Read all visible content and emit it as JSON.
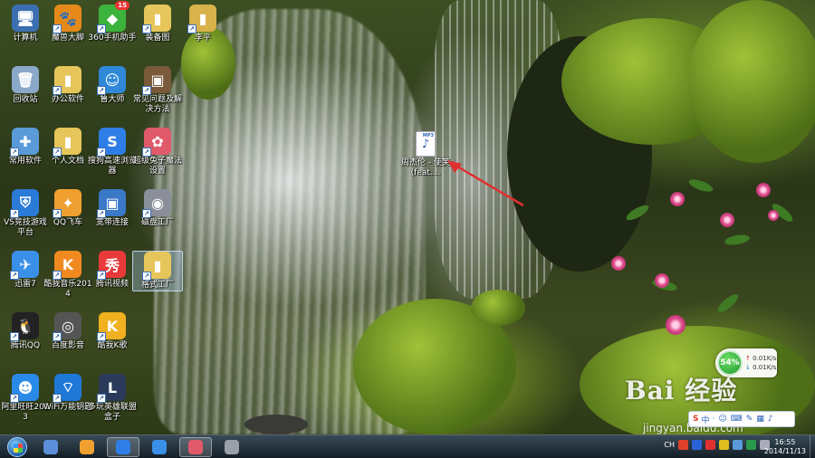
{
  "desktop_icons": [
    {
      "label": "计算机",
      "glyph": "🖥",
      "color": "#3b6fb0"
    },
    {
      "label": "魔兽大脚",
      "glyph": "🐾",
      "color": "#e58a1a"
    },
    {
      "label": "360手机助手",
      "glyph": "◆",
      "color": "#3cb33c",
      "badge": "15"
    },
    {
      "label": "装备图",
      "glyph": "▮",
      "color": "#e6c55a"
    },
    {
      "label": "李平",
      "glyph": "▮",
      "color": "#d8b24a"
    },
    {
      "label": "回收站",
      "glyph": "🗑",
      "color": "#8aa9c9"
    },
    {
      "label": "办公软件",
      "glyph": "▮",
      "color": "#e6c55a"
    },
    {
      "label": "鲁大师",
      "glyph": "☺",
      "color": "#2f88d8"
    },
    {
      "label": "常见问题及解决方法",
      "glyph": "▣",
      "color": "#7a5a3a"
    },
    {
      "label": "常用软件",
      "glyph": "✚",
      "color": "#5a9ad8"
    },
    {
      "label": "个人文档",
      "glyph": "▮",
      "color": "#e6c55a"
    },
    {
      "label": "搜狗高速浏览器",
      "glyph": "S",
      "color": "#2f7ee8"
    },
    {
      "label": "超级兔子魔法设置",
      "glyph": "✿",
      "color": "#e05a6a"
    },
    {
      "label": "VS竞技游戏平台",
      "glyph": "⛨",
      "color": "#2a7ad8"
    },
    {
      "label": "QQ飞车",
      "glyph": "✦",
      "color": "#f0a030"
    },
    {
      "label": "宽带连接",
      "glyph": "▣",
      "color": "#3a78c8"
    },
    {
      "label": "磁盘工厂",
      "glyph": "◉",
      "color": "#8a8f99"
    },
    {
      "label": "迅雷7",
      "glyph": "✈",
      "color": "#3a90e8"
    },
    {
      "label": "酷我音乐2014",
      "glyph": "K",
      "color": "#f08a20"
    },
    {
      "label": "腾讯视频",
      "glyph": "秀",
      "color": "#e83a3a"
    },
    {
      "label": "格式工厂",
      "glyph": "▮",
      "color": "#e6c55a"
    },
    {
      "label": "腾讯QQ",
      "glyph": "🐧",
      "color": "#222"
    },
    {
      "label": "百度影音",
      "glyph": "◎",
      "color": "#555"
    },
    {
      "label": "酷我K歌",
      "glyph": "K",
      "color": "#f0b020"
    },
    {
      "label": "阿里旺旺2013",
      "glyph": "☻",
      "color": "#2a8ae8"
    },
    {
      "label": "WiFi万能钥匙",
      "glyph": "⌔",
      "color": "#1e78d8"
    },
    {
      "label": "多玩英雄联盟盒子",
      "glyph": "L",
      "color": "#2a3a5a"
    }
  ],
  "file_icon": {
    "label": "周杰伦 - 使笑 (feat....",
    "type_label": "MP3",
    "glyph": "♪"
  },
  "net_speed": {
    "percent": "54%",
    "upload": "0.01K/s",
    "download": "0.01K/s"
  },
  "ime": {
    "brand": "S",
    "mode": "中",
    "items": [
      "·",
      "☺",
      "⌨",
      "✎",
      "▦",
      "♪"
    ]
  },
  "watermark": {
    "text": "Bai 经验",
    "url": "jingyan.baidu.com"
  },
  "taskbar": {
    "apps": [
      {
        "name": "media-player",
        "color": "#5b8fd8"
      },
      {
        "name": "360-browser",
        "color": "#f0a030"
      },
      {
        "name": "sogou-browser",
        "color": "#2f7ee8"
      },
      {
        "name": "xunlei",
        "color": "#3a90e8"
      },
      {
        "name": "superrabbit",
        "color": "#e05a6a"
      },
      {
        "name": "disk-factory",
        "color": "#9aa0aa"
      }
    ],
    "tray_text": "CH",
    "time": "16:55",
    "date": "2014/11/13"
  }
}
